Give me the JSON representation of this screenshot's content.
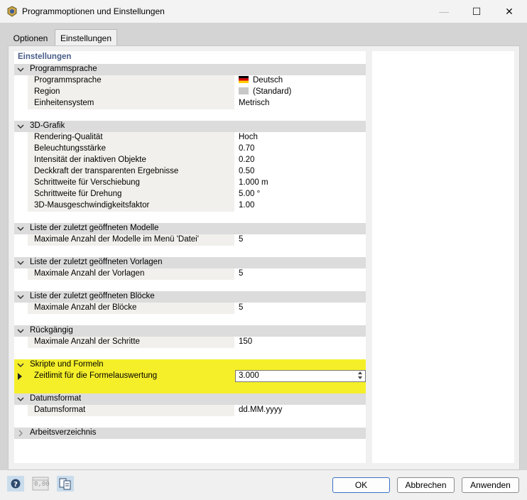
{
  "window": {
    "title": "Programmoptionen und Einstellungen",
    "minimize_glyph": "—",
    "maximize_glyph": "☐",
    "close_glyph": "✕"
  },
  "tabs": [
    {
      "label": "Optionen"
    },
    {
      "label": "Einstellungen"
    }
  ],
  "grid": {
    "header": "Einstellungen",
    "categories": {
      "programmsprache": {
        "label": "Programmsprache",
        "items": [
          {
            "label": "Programmsprache",
            "value": "Deutsch"
          },
          {
            "label": "Region",
            "value": "(Standard)"
          },
          {
            "label": "Einheitensystem",
            "value": "Metrisch"
          }
        ]
      },
      "grafik": {
        "label": "3D-Grafik",
        "items": [
          {
            "label": "Rendering-Qualität",
            "value": "Hoch"
          },
          {
            "label": "Beleuchtungsstärke",
            "value": "0.70"
          },
          {
            "label": "Intensität der inaktiven Objekte",
            "value": "0.20"
          },
          {
            "label": "Deckkraft der transparenten Ergebnisse",
            "value": "0.50"
          },
          {
            "label": "Schrittweite für Verschiebung",
            "value": "1.000 m"
          },
          {
            "label": "Schrittweite für Drehung",
            "value": "5.00 °"
          },
          {
            "label": "3D-Mausgeschwindigkeitsfaktor",
            "value": "1.00"
          }
        ]
      },
      "modelle": {
        "label": "Liste der zuletzt geöffneten Modelle",
        "items": [
          {
            "label": "Maximale Anzahl der Modelle im Menü 'Datei'",
            "value": "5"
          }
        ]
      },
      "vorlagen": {
        "label": "Liste der zuletzt geöffneten Vorlagen",
        "items": [
          {
            "label": "Maximale Anzahl der Vorlagen",
            "value": "5"
          }
        ]
      },
      "bloecke": {
        "label": "Liste der zuletzt geöffneten Blöcke",
        "items": [
          {
            "label": "Maximale Anzahl der Blöcke",
            "value": "5"
          }
        ]
      },
      "rueckgaengig": {
        "label": "Rückgängig",
        "items": [
          {
            "label": "Maximale Anzahl der Schritte",
            "value": "150"
          }
        ]
      },
      "skripte": {
        "label": "Skripte und Formeln",
        "items": [
          {
            "label": "Zeitlimit für die Formelauswertung",
            "value": "3.000"
          }
        ]
      },
      "datumsformat": {
        "label": "Datumsformat",
        "items": [
          {
            "label": "Datumsformat",
            "value": "dd.MM.yyyy"
          }
        ]
      },
      "arbeitsverzeichnis": {
        "label": "Arbeitsverzeichnis",
        "collapsed": true
      }
    }
  },
  "footer": {
    "tool_icons": [
      "help-icon",
      "number-format-icon",
      "copy-settings-icon"
    ],
    "number_format_label": "0,00",
    "ok_label": "OK",
    "cancel_label": "Abbrechen",
    "apply_label": "Anwenden"
  },
  "colors": {
    "highlight": "#f5ef2a",
    "category_bg": "#dcdcdc",
    "header_text": "#4a5e8a",
    "ok_border": "#3c72c6"
  }
}
